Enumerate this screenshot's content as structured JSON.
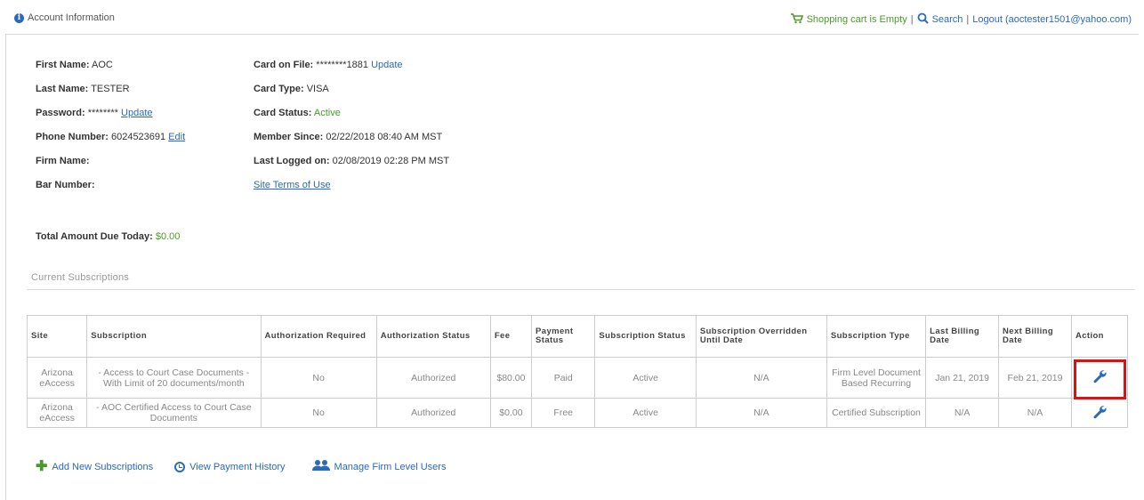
{
  "header": {
    "title": "Account Information",
    "cart_text": "Shopping cart is Empty",
    "separator": "|",
    "search_label": "Search",
    "logout_text": "Logout (aoctester1501@yahoo.com)"
  },
  "account": {
    "first_name_label": "First Name:",
    "first_name": "AOC",
    "last_name_label": "Last Name:",
    "last_name": "TESTER",
    "password_label": "Password:",
    "password": "********",
    "password_update": "Update",
    "phone_label": "Phone Number:",
    "phone": "6024523691",
    "phone_edit": "Edit",
    "firm_label": "Firm Name:",
    "bar_label": "Bar Number:",
    "card_label": "Card on File:",
    "card": "********1881",
    "card_update": "Update",
    "card_type_label": "Card Type:",
    "card_type": "VISA",
    "card_status_label": "Card Status:",
    "card_status": "Active",
    "member_since_label": "Member Since:",
    "member_since": "02/22/2018 08:40 AM MST",
    "last_logged_label": "Last Logged on:",
    "last_logged": "02/08/2019 02:28 PM MST",
    "terms_link": "Site Terms of Use",
    "total_label": "Total Amount Due Today:",
    "total": "$0.00"
  },
  "subscriptions": {
    "section_title": "Current Subscriptions",
    "headers": [
      "Site",
      "Subscription",
      "Authorization Required",
      "Authorization Status",
      "Fee",
      "Payment Status",
      "Subscription Status",
      "Subscription Overridden Until Date",
      "Subscription Type",
      "Last Billing Date",
      "Next Billing Date",
      "Action"
    ],
    "rows": [
      [
        "Arizona eAccess",
        "- Access to Court Case Documents - With Limit of 20 documents/month",
        "No",
        "Authorized",
        "$80.00",
        "Paid",
        "Active",
        "N/A",
        "Firm Level Document Based Recurring",
        "Jan 21, 2019",
        "Feb 21, 2019"
      ],
      [
        "Arizona eAccess",
        "- AOC Certified Access to Court Case Documents",
        "No",
        "Authorized",
        "$0.00",
        "Free",
        "Active",
        "N/A",
        "Certified Subscription",
        "N/A",
        "N/A"
      ]
    ]
  },
  "footer_links": {
    "add": "Add New Subscriptions",
    "history": "View Payment History",
    "manage": "Manage Firm Level Users"
  },
  "icons": [
    "info-icon",
    "cart-icon",
    "search-icon",
    "wrench-icon",
    "plus-icon",
    "clock-icon",
    "users-icon"
  ],
  "colors": {
    "link": "#2a6ab8",
    "green": "#4a9a2a",
    "highlight": "#dd1111"
  }
}
